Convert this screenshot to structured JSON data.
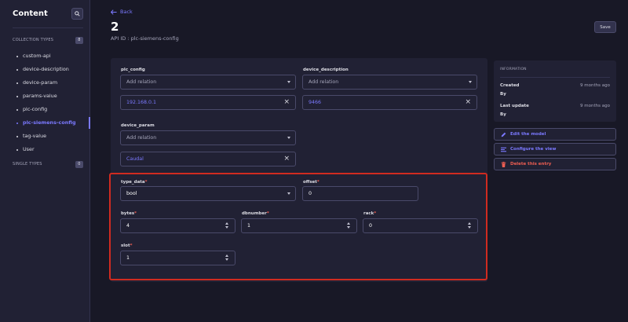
{
  "sidebar": {
    "title": "Content",
    "collection_types_label": "COLLECTION TYPES",
    "collection_types_count": "8",
    "items": [
      {
        "label": "custom-api"
      },
      {
        "label": "device-description"
      },
      {
        "label": "device-param"
      },
      {
        "label": "params-value"
      },
      {
        "label": "plc-config"
      },
      {
        "label": "plc-siemens-config"
      },
      {
        "label": "tag-value"
      },
      {
        "label": "User"
      }
    ],
    "single_types_label": "SINGLE TYPES",
    "single_types_count": "0"
  },
  "header": {
    "back_label": "Back",
    "title": "2",
    "api_id": "API ID : plc-siemens-config",
    "save_label": "Save"
  },
  "form": {
    "plc_config": {
      "label": "plc_config",
      "placeholder": "Add relation",
      "relation_value": "192.168.0.1"
    },
    "device_description": {
      "label": "device_description",
      "placeholder": "Add relation",
      "relation_value": "9466"
    },
    "device_param": {
      "label": "device_param",
      "placeholder": "Add relation",
      "relation_value": "Caudal"
    },
    "type_data": {
      "label": "type_data",
      "required": "*",
      "value": "bool"
    },
    "offset": {
      "label": "offset",
      "required": "*",
      "value": "0"
    },
    "bytes": {
      "label": "bytes",
      "required": "*",
      "value": "4"
    },
    "dbnumber": {
      "label": "dbnumber",
      "required": "*",
      "value": "1"
    },
    "rack": {
      "label": "rack",
      "required": "*",
      "value": "0"
    },
    "slot": {
      "label": "slot",
      "required": "*",
      "value": "1"
    }
  },
  "info": {
    "title": "INFORMATION",
    "created_label": "Created",
    "created_value": "9 months ago",
    "created_by_label": "By",
    "updated_label": "Last update",
    "updated_value": "9 months ago",
    "updated_by_label": "By"
  },
  "actions": {
    "edit_model": "Edit the model",
    "configure_view": "Configure the view",
    "delete_entry": "Delete this entry"
  },
  "colors": {
    "accent": "#7b79ff",
    "danger": "#ee5e52",
    "highlight": "#d02b20",
    "background": "#181826",
    "surface": "#212134"
  }
}
